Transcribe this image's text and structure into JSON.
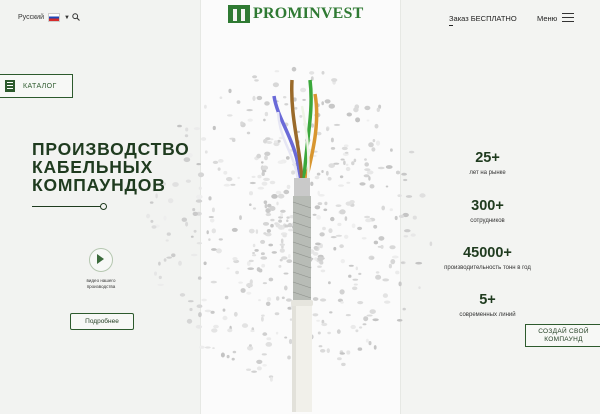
{
  "header": {
    "language": "Русский",
    "logo_text": "PROMINVEST",
    "order_label": "Заказ БЕСПЛАТНО",
    "menu_label": "Меню"
  },
  "catalog": {
    "label": "КАТАЛОГ"
  },
  "hero": {
    "title_lines": [
      "ПРОИЗВОДСТВО",
      "КАБЕЛЬНЫХ",
      "КОМПАУНДОВ"
    ]
  },
  "video": {
    "label_line1": "видео нашего",
    "label_line2": "производства"
  },
  "more_button": {
    "label": "Подробнее"
  },
  "stats": [
    {
      "value": "25+",
      "label": "лет на рынке"
    },
    {
      "value": "300+",
      "label": "сотрудников"
    },
    {
      "value": "45000+",
      "label": "производительность тонн в год"
    },
    {
      "value": "5+",
      "label": "современных линий"
    }
  ],
  "create_button": {
    "line1": "СОЗДАЙ СВОЙ",
    "line2": "КОМПАУНД"
  },
  "colors": {
    "brand_green": "#2f7a33",
    "dark_green": "#1f3b1f"
  }
}
